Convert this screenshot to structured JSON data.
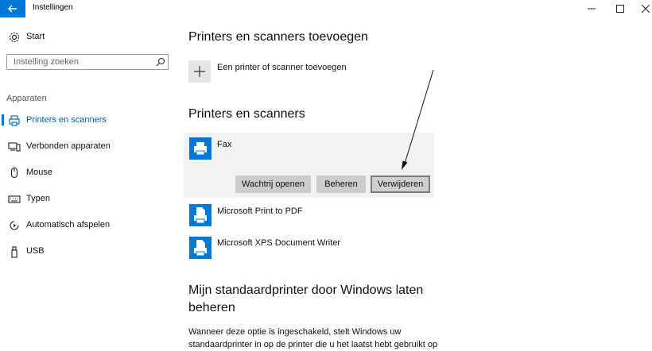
{
  "window": {
    "title": "Instellingen",
    "back_icon": "back-arrow-icon",
    "controls": {
      "minimize": "–",
      "maximize": "☐",
      "close": "✕"
    },
    "accent": "#0078d7"
  },
  "sidebar": {
    "home": {
      "label": "Start",
      "icon": "gear-icon"
    },
    "search": {
      "placeholder": "Instelling zoeken",
      "icon": "search-icon"
    },
    "group_label": "Apparaten",
    "items": [
      {
        "label": "Printers en scanners",
        "icon": "printer-icon",
        "active": true
      },
      {
        "label": "Verbonden apparaten",
        "icon": "devices-icon",
        "active": false
      },
      {
        "label": "Mouse",
        "icon": "mouse-icon",
        "active": false
      },
      {
        "label": "Typen",
        "icon": "keyboard-icon",
        "active": false
      },
      {
        "label": "Automatisch afspelen",
        "icon": "autoplay-icon",
        "active": false
      },
      {
        "label": "USB",
        "icon": "usb-icon",
        "active": false
      }
    ]
  },
  "main": {
    "add_section": {
      "heading": "Printers en scanners toevoegen",
      "add_label": "Een printer of scanner toevoegen"
    },
    "list_section": {
      "heading": "Printers en scanners",
      "devices": [
        {
          "name": "Fax",
          "selected": true
        },
        {
          "name": "Microsoft Print to PDF",
          "selected": false
        },
        {
          "name": "Microsoft XPS Document Writer",
          "selected": false
        }
      ],
      "actions": {
        "open_queue": "Wachtrij openen",
        "manage": "Beheren",
        "remove": "Verwijderen"
      }
    },
    "default_section": {
      "heading_line1": "Mijn standaardprinter door Windows laten",
      "heading_line2": "beheren",
      "description_line1": "Wanneer deze optie is ingeschakeld, stelt Windows uw",
      "description_line2": "standaardprinter in op de printer die u het laatst hebt gebruikt op"
    }
  }
}
